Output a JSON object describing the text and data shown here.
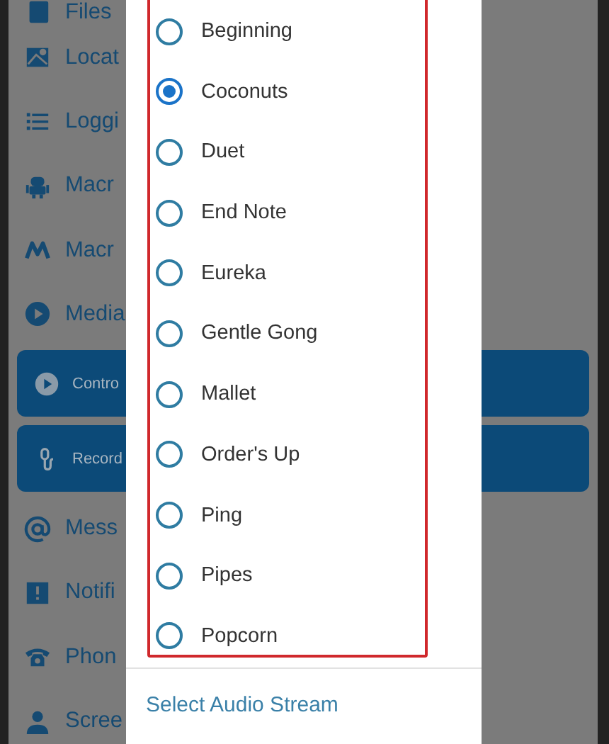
{
  "background_menu": {
    "items": [
      {
        "kind": "row",
        "label": "Files"
      },
      {
        "kind": "row",
        "label": "Locat"
      },
      {
        "kind": "row",
        "label": "Loggi"
      },
      {
        "kind": "row",
        "label": "Macr"
      },
      {
        "kind": "row",
        "label": "Macr"
      },
      {
        "kind": "row",
        "label": "Media"
      },
      {
        "kind": "button",
        "label": "Contro"
      },
      {
        "kind": "button",
        "label": "Record"
      },
      {
        "kind": "row",
        "label": "Mess"
      },
      {
        "kind": "row",
        "label": "Notifi"
      },
      {
        "kind": "row",
        "label": "Phon"
      },
      {
        "kind": "row",
        "label": "Scree"
      }
    ]
  },
  "dialog": {
    "options": [
      {
        "label": "Beginning",
        "selected": false
      },
      {
        "label": "Coconuts",
        "selected": true
      },
      {
        "label": "Duet",
        "selected": false
      },
      {
        "label": "End Note",
        "selected": false
      },
      {
        "label": "Eureka",
        "selected": false
      },
      {
        "label": "Gentle Gong",
        "selected": false
      },
      {
        "label": "Mallet",
        "selected": false
      },
      {
        "label": "Order's Up",
        "selected": false
      },
      {
        "label": "Ping",
        "selected": false
      },
      {
        "label": "Pipes",
        "selected": false
      },
      {
        "label": "Popcorn",
        "selected": false
      }
    ],
    "footer_action": "Select Audio Stream"
  }
}
